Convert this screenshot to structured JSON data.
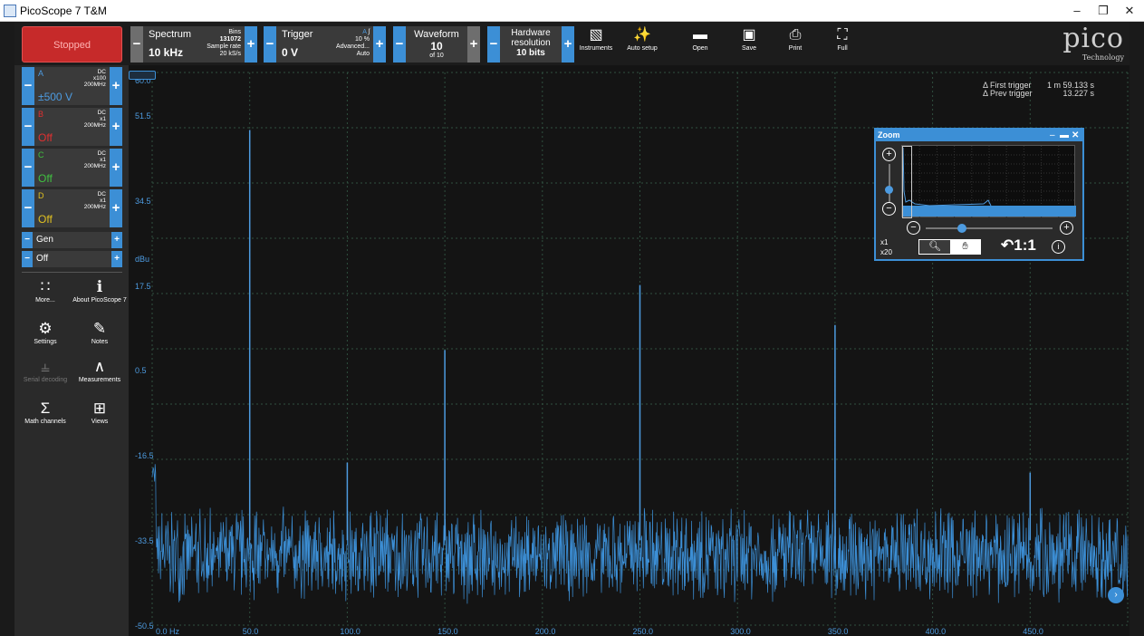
{
  "window": {
    "title": "PicoScope 7 T&M",
    "minimize": "–",
    "restore": "❐",
    "close": "✕"
  },
  "toolbar": {
    "run_state": "Stopped",
    "spectrum": {
      "label": "Spectrum",
      "value": "10 kHz",
      "bins_label": "Bins",
      "bins": "131072",
      "rate_label": "Sample rate",
      "rate": "20 kS/s"
    },
    "trigger": {
      "label": "Trigger",
      "value": "0 V",
      "source": "A",
      "edge": "ʃ",
      "pct": "10 %",
      "mode": "Advanced...",
      "auto": "Auto"
    },
    "waveform": {
      "label": "Waveform",
      "value": "10",
      "of": "of 10"
    },
    "hardware": {
      "label1": "Hardware",
      "label2": "resolution",
      "value": "10 bits"
    },
    "tools": [
      {
        "name": "instruments",
        "label": "Instruments",
        "icon": "▧"
      },
      {
        "name": "auto-setup",
        "label": "Auto setup",
        "icon": "✨"
      },
      {
        "name": "open",
        "label": "Open",
        "icon": "▬"
      },
      {
        "name": "save",
        "label": "Save",
        "icon": "▣"
      },
      {
        "name": "print",
        "label": "Print",
        "icon": "⎙"
      },
      {
        "name": "full",
        "label": "Full",
        "icon": "⛶"
      }
    ],
    "logo_word": "pico",
    "logo_sub": "Technology"
  },
  "channels": [
    {
      "name": "A",
      "value": "±500 V",
      "spec1": "DC",
      "spec2": "x100",
      "spec3": "200MHz",
      "color": "#4d9be0"
    },
    {
      "name": "B",
      "value": "Off",
      "spec1": "DC",
      "spec2": "x1",
      "spec3": "200MHz",
      "color": "#e03030"
    },
    {
      "name": "C",
      "value": "Off",
      "spec1": "DC",
      "spec2": "x1",
      "spec3": "200MHz",
      "color": "#40c040"
    },
    {
      "name": "D",
      "value": "Off",
      "spec1": "DC",
      "spec2": "x1",
      "spec3": "200MHz",
      "color": "#e0c020"
    }
  ],
  "generator": {
    "label": "Gen",
    "state": "Off"
  },
  "side_tools": [
    {
      "label": "More...",
      "icon": "∷"
    },
    {
      "label": "About PicoScope 7",
      "icon": "ℹ"
    },
    {
      "label": "Settings",
      "icon": "⚙"
    },
    {
      "label": "Notes",
      "icon": "✎"
    },
    {
      "label": "Serial decoding",
      "icon": "⫨"
    },
    {
      "label": "Measurements",
      "icon": "∧"
    },
    {
      "label": "Math channels",
      "icon": "Σ"
    },
    {
      "label": "Views",
      "icon": "⊞"
    }
  ],
  "chart_data": {
    "type": "line",
    "ylabel": "dBu",
    "ylim": [
      -50.5,
      60.0
    ],
    "yticks": [
      "60.0",
      "51.5",
      "34.5",
      "17.5",
      "0.5",
      "-16.5",
      "-33.5",
      "-50.5"
    ],
    "xticks": [
      "0.0 Hz",
      "50.0",
      "100.0",
      "150.0",
      "200.0",
      "250.0",
      "300.0",
      "350.0",
      "400.0",
      "450.0"
    ],
    "xlim": [
      0,
      500
    ],
    "noise_floor_dbu": -33.5,
    "peaks": [
      {
        "x": 50,
        "y": 48.5
      },
      {
        "x": 100,
        "y": -18.0
      },
      {
        "x": 150,
        "y": 4.5
      },
      {
        "x": 250,
        "y": 17.5
      },
      {
        "x": 350,
        "y": 9.5
      },
      {
        "x": 450,
        "y": -20.0
      }
    ],
    "grid": true
  },
  "trigger_info": {
    "first_label": "Δ First trigger",
    "prev_label": "Δ Prev trigger",
    "first_val": "1 m 59.133 s",
    "prev_val": "13.227 s"
  },
  "zoom": {
    "title": "Zoom",
    "x1": "x1",
    "x20": "x20",
    "reset": "1:1"
  }
}
